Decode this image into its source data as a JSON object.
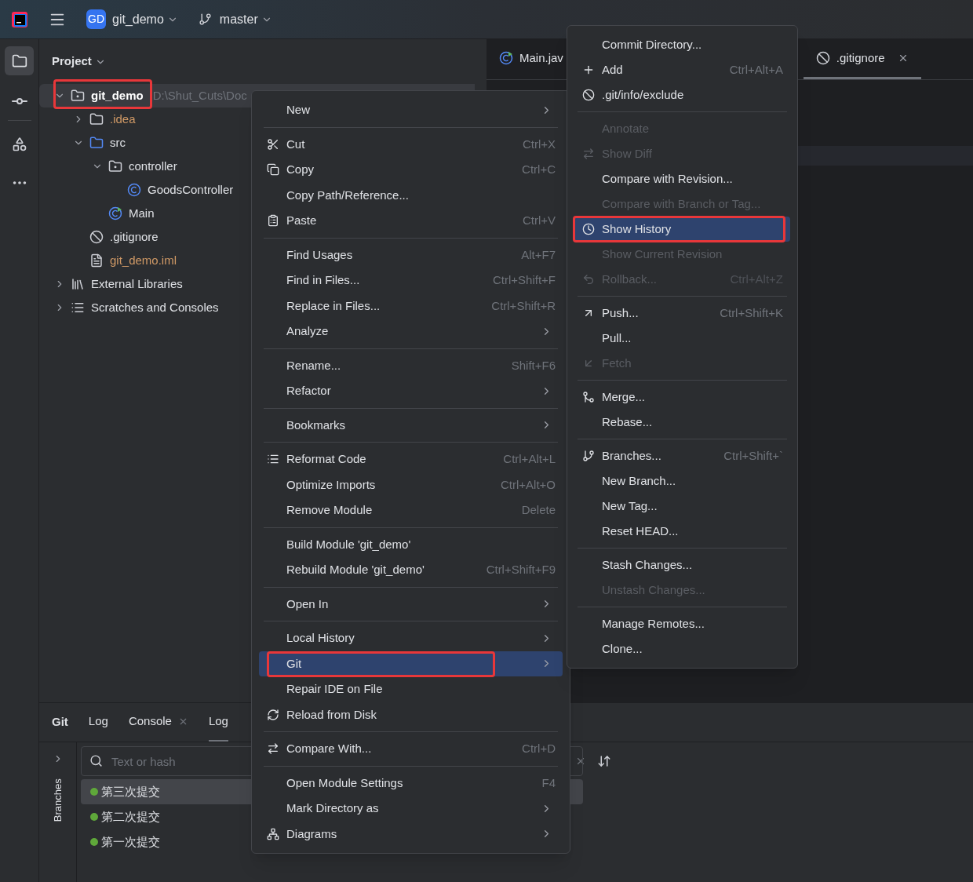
{
  "title_bar": {
    "project_badge": "GD",
    "project": "git_demo",
    "branch": "master"
  },
  "project_panel": {
    "title": "Project",
    "tree": [
      {
        "label": "git_demo",
        "path": "D:\\Shut_Cuts\\Doc",
        "kind": "module",
        "expanded": true,
        "selected": true,
        "children": [
          {
            "label": ".idea",
            "kind": "folder",
            "expanded": false,
            "color": "#d19a66"
          },
          {
            "label": "src",
            "kind": "source",
            "expanded": true,
            "children": [
              {
                "label": "controller",
                "kind": "package",
                "expanded": true,
                "children": [
                  {
                    "label": "GoodsController",
                    "kind": "class"
                  }
                ]
              },
              {
                "label": "Main",
                "kind": "main"
              }
            ]
          },
          {
            "label": ".gitignore",
            "kind": "ignore"
          },
          {
            "label": "git_demo.iml",
            "kind": "iml",
            "color": "#d19a66"
          }
        ]
      },
      {
        "label": "External Libraries",
        "kind": "libraries",
        "expanded": false
      },
      {
        "label": "Scratches and Consoles",
        "kind": "scratches",
        "expanded": false
      }
    ]
  },
  "editor_tabs": [
    {
      "label": "Main.jav",
      "selected": false
    },
    {
      "label": ".gitignore",
      "selected": true,
      "closable": true
    }
  ],
  "bottom_panel": {
    "title": "Git",
    "tabs": [
      {
        "label": "Log",
        "selected": false
      },
      {
        "label": "Console",
        "selected": false,
        "closable": true
      },
      {
        "label": "Log",
        "selected": true
      }
    ],
    "branches_label": "Branches",
    "search": {
      "placeholder": "Text or hash"
    },
    "commits": [
      {
        "message": "第三次提交",
        "selected": true
      },
      {
        "message": "第二次提交",
        "selected": false
      },
      {
        "message": "第一次提交",
        "selected": false
      }
    ]
  },
  "context_menu": [
    {
      "kind": "item",
      "label": "New",
      "submenu": true
    },
    {
      "kind": "separator"
    },
    {
      "kind": "item",
      "label": "Cut",
      "shortcut": "Ctrl+X"
    },
    {
      "kind": "item",
      "label": "Copy",
      "shortcut": "Ctrl+C"
    },
    {
      "kind": "item",
      "label": "Copy Path/Reference..."
    },
    {
      "kind": "item",
      "label": "Paste",
      "shortcut": "Ctrl+V"
    },
    {
      "kind": "separator"
    },
    {
      "kind": "item",
      "label": "Find Usages",
      "shortcut": "Alt+F7"
    },
    {
      "kind": "item",
      "label": "Find in Files...",
      "shortcut": "Ctrl+Shift+F"
    },
    {
      "kind": "item",
      "label": "Replace in Files...",
      "shortcut": "Ctrl+Shift+R"
    },
    {
      "kind": "item",
      "label": "Analyze",
      "submenu": true
    },
    {
      "kind": "separator"
    },
    {
      "kind": "item",
      "label": "Rename...",
      "shortcut": "Shift+F6"
    },
    {
      "kind": "item",
      "label": "Refactor",
      "submenu": true
    },
    {
      "kind": "separator"
    },
    {
      "kind": "item",
      "label": "Bookmarks",
      "submenu": true
    },
    {
      "kind": "separator"
    },
    {
      "kind": "item",
      "label": "Reformat Code",
      "shortcut": "Ctrl+Alt+L"
    },
    {
      "kind": "item",
      "label": "Optimize Imports",
      "shortcut": "Ctrl+Alt+O"
    },
    {
      "kind": "item",
      "label": "Remove Module",
      "shortcut": "Delete"
    },
    {
      "kind": "separator"
    },
    {
      "kind": "item",
      "label": "Build Module 'git_demo'"
    },
    {
      "kind": "item",
      "label": "Rebuild Module 'git_demo'",
      "shortcut": "Ctrl+Shift+F9"
    },
    {
      "kind": "separator"
    },
    {
      "kind": "item",
      "label": "Open In",
      "submenu": true
    },
    {
      "kind": "separator"
    },
    {
      "kind": "item",
      "label": "Local History",
      "submenu": true
    },
    {
      "kind": "item",
      "label": "Git",
      "submenu": true,
      "selected": true
    },
    {
      "kind": "item",
      "label": "Repair IDE on File"
    },
    {
      "kind": "item",
      "label": "Reload from Disk"
    },
    {
      "kind": "separator"
    },
    {
      "kind": "item",
      "label": "Compare With...",
      "shortcut": "Ctrl+D"
    },
    {
      "kind": "separator"
    },
    {
      "kind": "item",
      "label": "Open Module Settings",
      "shortcut": "F4"
    },
    {
      "kind": "item",
      "label": "Mark Directory as",
      "submenu": true
    },
    {
      "kind": "item",
      "label": "Diagrams",
      "submenu": true
    }
  ],
  "git_menu": [
    {
      "kind": "item",
      "label": "Commit Directory..."
    },
    {
      "kind": "item",
      "label": "Add",
      "shortcut": "Ctrl+Alt+A"
    },
    {
      "kind": "item",
      "label": ".git/info/exclude"
    },
    {
      "kind": "separator"
    },
    {
      "kind": "item",
      "label": "Annotate",
      "disabled": true
    },
    {
      "kind": "item",
      "label": "Show Diff",
      "disabled": true
    },
    {
      "kind": "item",
      "label": "Compare with Revision..."
    },
    {
      "kind": "item",
      "label": "Compare with Branch or Tag...",
      "disabled": true
    },
    {
      "kind": "item",
      "label": "Show History",
      "selected": true
    },
    {
      "kind": "item",
      "label": "Show Current Revision",
      "disabled": true
    },
    {
      "kind": "item",
      "label": "Rollback...",
      "shortcut": "Ctrl+Alt+Z",
      "disabled": true
    },
    {
      "kind": "separator"
    },
    {
      "kind": "item",
      "label": "Push...",
      "shortcut": "Ctrl+Shift+K"
    },
    {
      "kind": "item",
      "label": "Pull..."
    },
    {
      "kind": "item",
      "label": "Fetch",
      "disabled": true
    },
    {
      "kind": "separator"
    },
    {
      "kind": "item",
      "label": "Merge..."
    },
    {
      "kind": "item",
      "label": "Rebase..."
    },
    {
      "kind": "separator"
    },
    {
      "kind": "item",
      "label": "Branches...",
      "shortcut": "Ctrl+Shift+`"
    },
    {
      "kind": "item",
      "label": "New Branch..."
    },
    {
      "kind": "item",
      "label": "New Tag..."
    },
    {
      "kind": "item",
      "label": "Reset HEAD..."
    },
    {
      "kind": "separator"
    },
    {
      "kind": "item",
      "label": "Stash Changes..."
    },
    {
      "kind": "item",
      "label": "Unstash Changes...",
      "disabled": true
    },
    {
      "kind": "separator"
    },
    {
      "kind": "item",
      "label": "Manage Remotes..."
    },
    {
      "kind": "item",
      "label": "Clone..."
    }
  ]
}
